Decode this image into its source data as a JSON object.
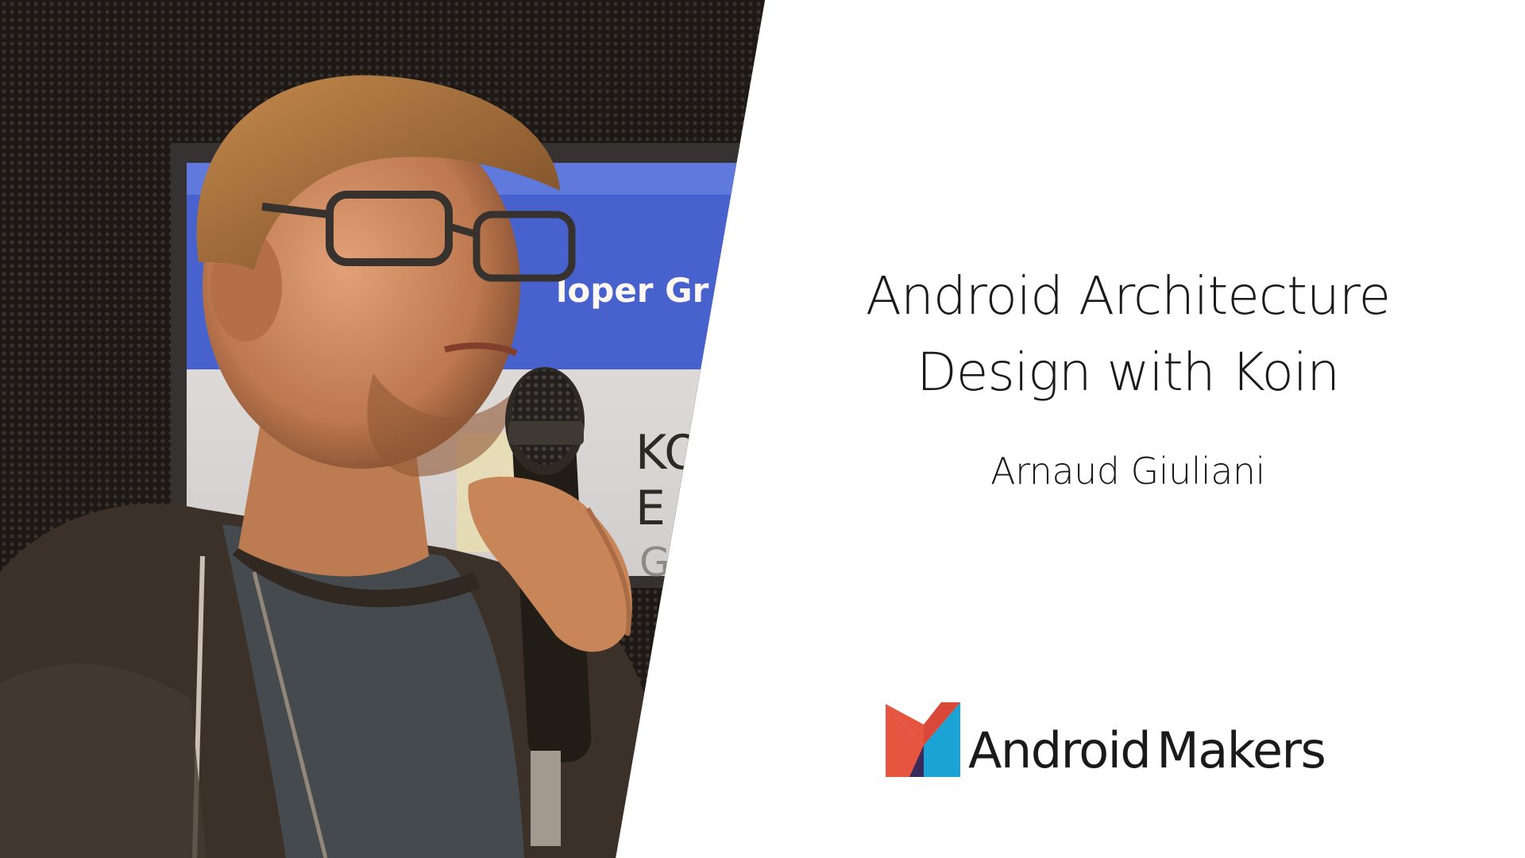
{
  "slide": {
    "title_line_1": "Android Architecture",
    "title_line_2": "Design with Koin",
    "speaker_name": "Arnaud Giuliani"
  },
  "photo": {
    "screen_text_1": "loper Gr",
    "screen_text_2": "KO",
    "screen_text_3": "E",
    "screen_text_4": "G"
  },
  "logo": {
    "word_1": "Android",
    "word_2": "Makers",
    "colors": {
      "red": "#e5553f",
      "blue": "#1ca3d6",
      "dark": "#3a2a5a"
    }
  }
}
